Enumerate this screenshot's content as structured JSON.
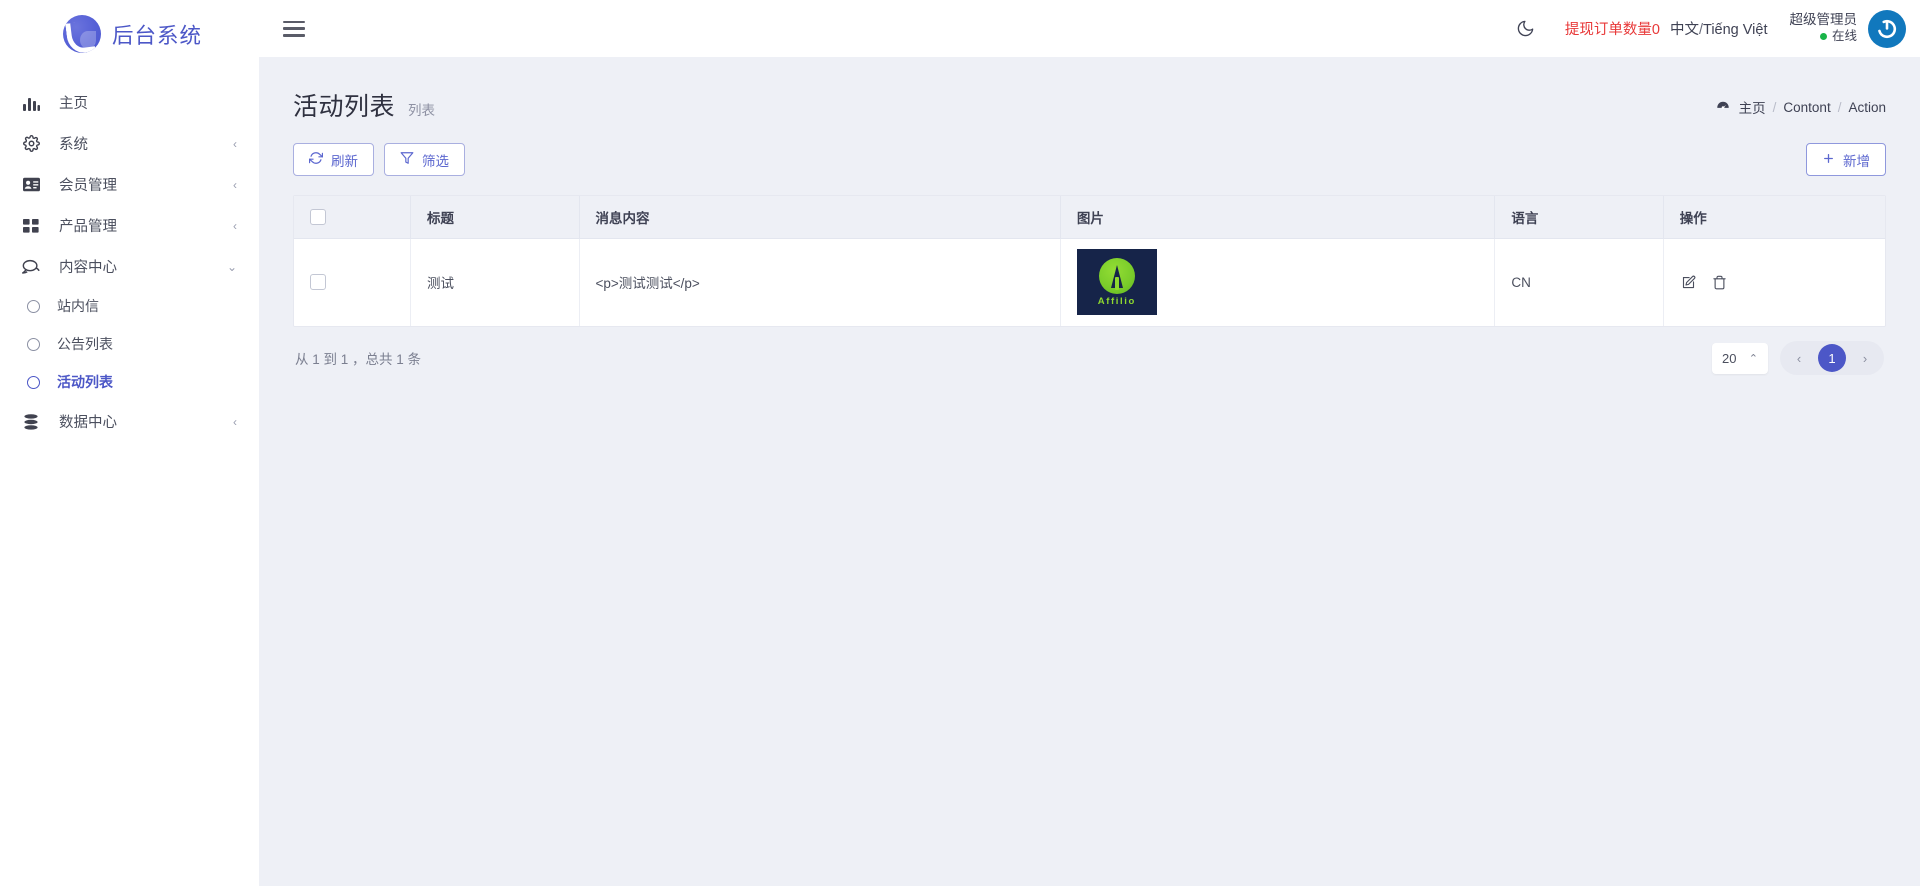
{
  "brand": {
    "name": "后台系统",
    "logo_icon": "swoosh-circle-logo"
  },
  "sidebar": {
    "items": [
      {
        "label": "主页",
        "icon": "bar-chart-icon",
        "has_caret": false
      },
      {
        "label": "系统",
        "icon": "gear-icon",
        "has_caret": true,
        "caret": "‹"
      },
      {
        "label": "会员管理",
        "icon": "id-card-icon",
        "has_caret": true,
        "caret": "‹"
      },
      {
        "label": "产品管理",
        "icon": "grid-icon",
        "has_caret": true,
        "caret": "‹"
      },
      {
        "label": "内容中心",
        "icon": "chat-bubbles-icon",
        "has_caret": true,
        "caret": "⌄",
        "expanded": true
      },
      {
        "label": "数据中心",
        "icon": "database-icon",
        "has_caret": true,
        "caret": "‹"
      }
    ],
    "sub_items": [
      {
        "label": "站内信",
        "active": false
      },
      {
        "label": "公告列表",
        "active": false
      },
      {
        "label": "活动列表",
        "active": true
      }
    ]
  },
  "topbar": {
    "menu_icon": "hamburger-icon",
    "theme_icon": "moon-icon",
    "withdraw_label": "提现订单数量0",
    "lang_cn": "中文",
    "lang_sep": "/",
    "lang_vi": "Tiếng Việt",
    "user_name": "超级管理员",
    "user_status": "在线",
    "avatar_icon": "power-circle-avatar"
  },
  "page": {
    "title": "活动列表",
    "subtitle": "列表"
  },
  "breadcrumb": {
    "icon": "dashboard-icon",
    "items": [
      "主页",
      "Contont",
      "Action"
    ],
    "separator": "/"
  },
  "toolbar": {
    "refresh_label": "刷新",
    "refresh_icon": "refresh-icon",
    "filter_label": "筛选",
    "filter_icon": "funnel-icon",
    "add_label": "新增",
    "add_icon": "plus-icon"
  },
  "table": {
    "columns": [
      "",
      "标题",
      "消息内容",
      "图片",
      "语言",
      "操作"
    ],
    "rows": [
      {
        "title": "测试",
        "content": "<p>测试测试</p>",
        "image_alt": "Affilio",
        "image_text": "Affilio",
        "language": "CN",
        "edit_icon": "edit-icon",
        "delete_icon": "trash-icon"
      }
    ]
  },
  "pagination": {
    "info": "从 1 到 1 ，总共 1 条",
    "page_size": "20",
    "page_size_caret": "⌃",
    "prev": "‹",
    "next": "›",
    "current_page": "1"
  },
  "colors": {
    "accent": "#4c57c7",
    "brand_text": "#4c57c7",
    "danger": "#e83838",
    "online": "#19b449",
    "page_bg": "#eef0f6",
    "thumb_bg": "#162449",
    "thumb_green": "#8fd92f",
    "avatar_blue": "#1178bd"
  }
}
